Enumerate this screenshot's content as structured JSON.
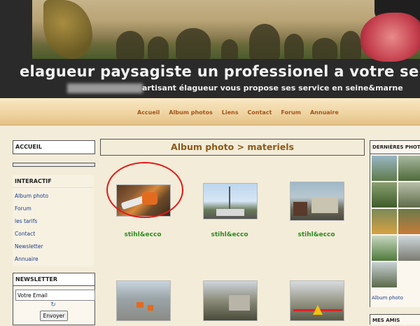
{
  "header": {
    "site_title": "elagueur paysagiste un professionel a votre serv",
    "subtitle": "artisant élagueur vous propose ses service en seine&marne"
  },
  "nav": {
    "items": [
      "Accueil",
      "Album photos",
      "Liens",
      "Contact",
      "Forum",
      "Annuaire"
    ]
  },
  "sidebar": {
    "accueil_title": "ACCUEIL",
    "interactif_title": "INTERACTIF",
    "interactif_items": [
      "Album photo",
      "Forum",
      "les tarifs",
      "Contact",
      "Newsletter",
      "Annuaire"
    ],
    "newsletter_title": "NEWSLETTER",
    "email_value": "Votre Email",
    "envoyer_label": "Envoyer"
  },
  "main": {
    "heading": "Album photo > materiels",
    "photos": [
      {
        "caption": "stihl&ecco"
      },
      {
        "caption": "stihl&ecco"
      },
      {
        "caption": "stihl&ecco"
      },
      {
        "caption": ""
      },
      {
        "caption": ""
      },
      {
        "caption": ""
      }
    ]
  },
  "right": {
    "title": "DERNIÈRES PHOTOS",
    "album_link": "Album photo",
    "mes_amis_title": "MES AMIS"
  },
  "colors": {
    "nav_link": "#a2531a",
    "caption_green": "#2e8b20",
    "link_blue": "#1a3e8c",
    "highlight_red": "#e01a1a"
  }
}
